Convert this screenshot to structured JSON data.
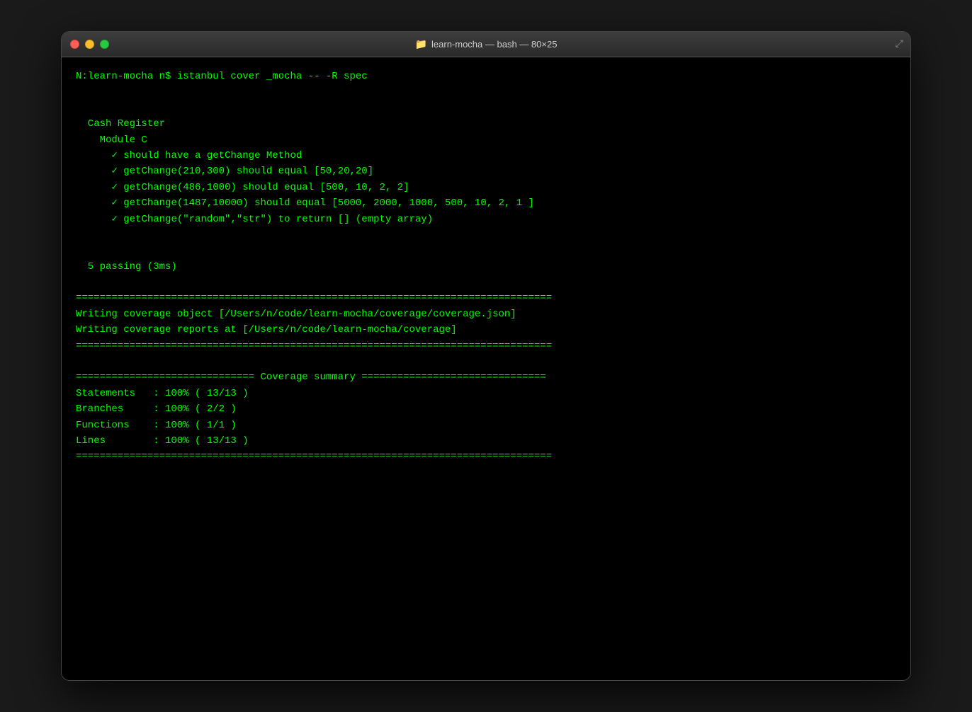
{
  "window": {
    "title": "learn-mocha — bash — 80×25",
    "title_icon": "📁"
  },
  "terminal": {
    "prompt": "N:learn-mocha n$ istanbul cover _mocha -- -R spec",
    "blank1": "",
    "blank2": "",
    "suite_name": "  Cash Register",
    "module_name": "    Module C",
    "test1": "      ✓ should have a getChange Method",
    "test2": "      ✓ getChange(210,300) should equal [50,20,20]",
    "test3": "      ✓ getChange(486,1000) should equal [500, 10, 2, 2]",
    "test4": "      ✓ getChange(1487,10000) should equal [5000, 2000, 1000, 500, 10, 2, 1 ]",
    "test5": "      ✓ getChange(\"random\",\"str\") to return [] (empty array)",
    "blank3": "",
    "blank4": "",
    "passing": "  5 passing (3ms)",
    "blank5": "",
    "divider1": "================================================================================",
    "writing1": "Writing coverage object [/Users/n/code/learn-mocha/coverage/coverage.json]",
    "writing2": "Writing coverage reports at [/Users/n/code/learn-mocha/coverage]",
    "divider2": "================================================================================",
    "blank6": "",
    "coverage_summary": "============================== Coverage summary ===============================",
    "statements": "Statements   : 100% ( 13/13 )",
    "branches": "Branches     : 100% ( 2/2 )",
    "functions": "Functions    : 100% ( 1/1 )",
    "lines": "Lines        : 100% ( 13/13 )",
    "divider3": "================================================================================"
  }
}
